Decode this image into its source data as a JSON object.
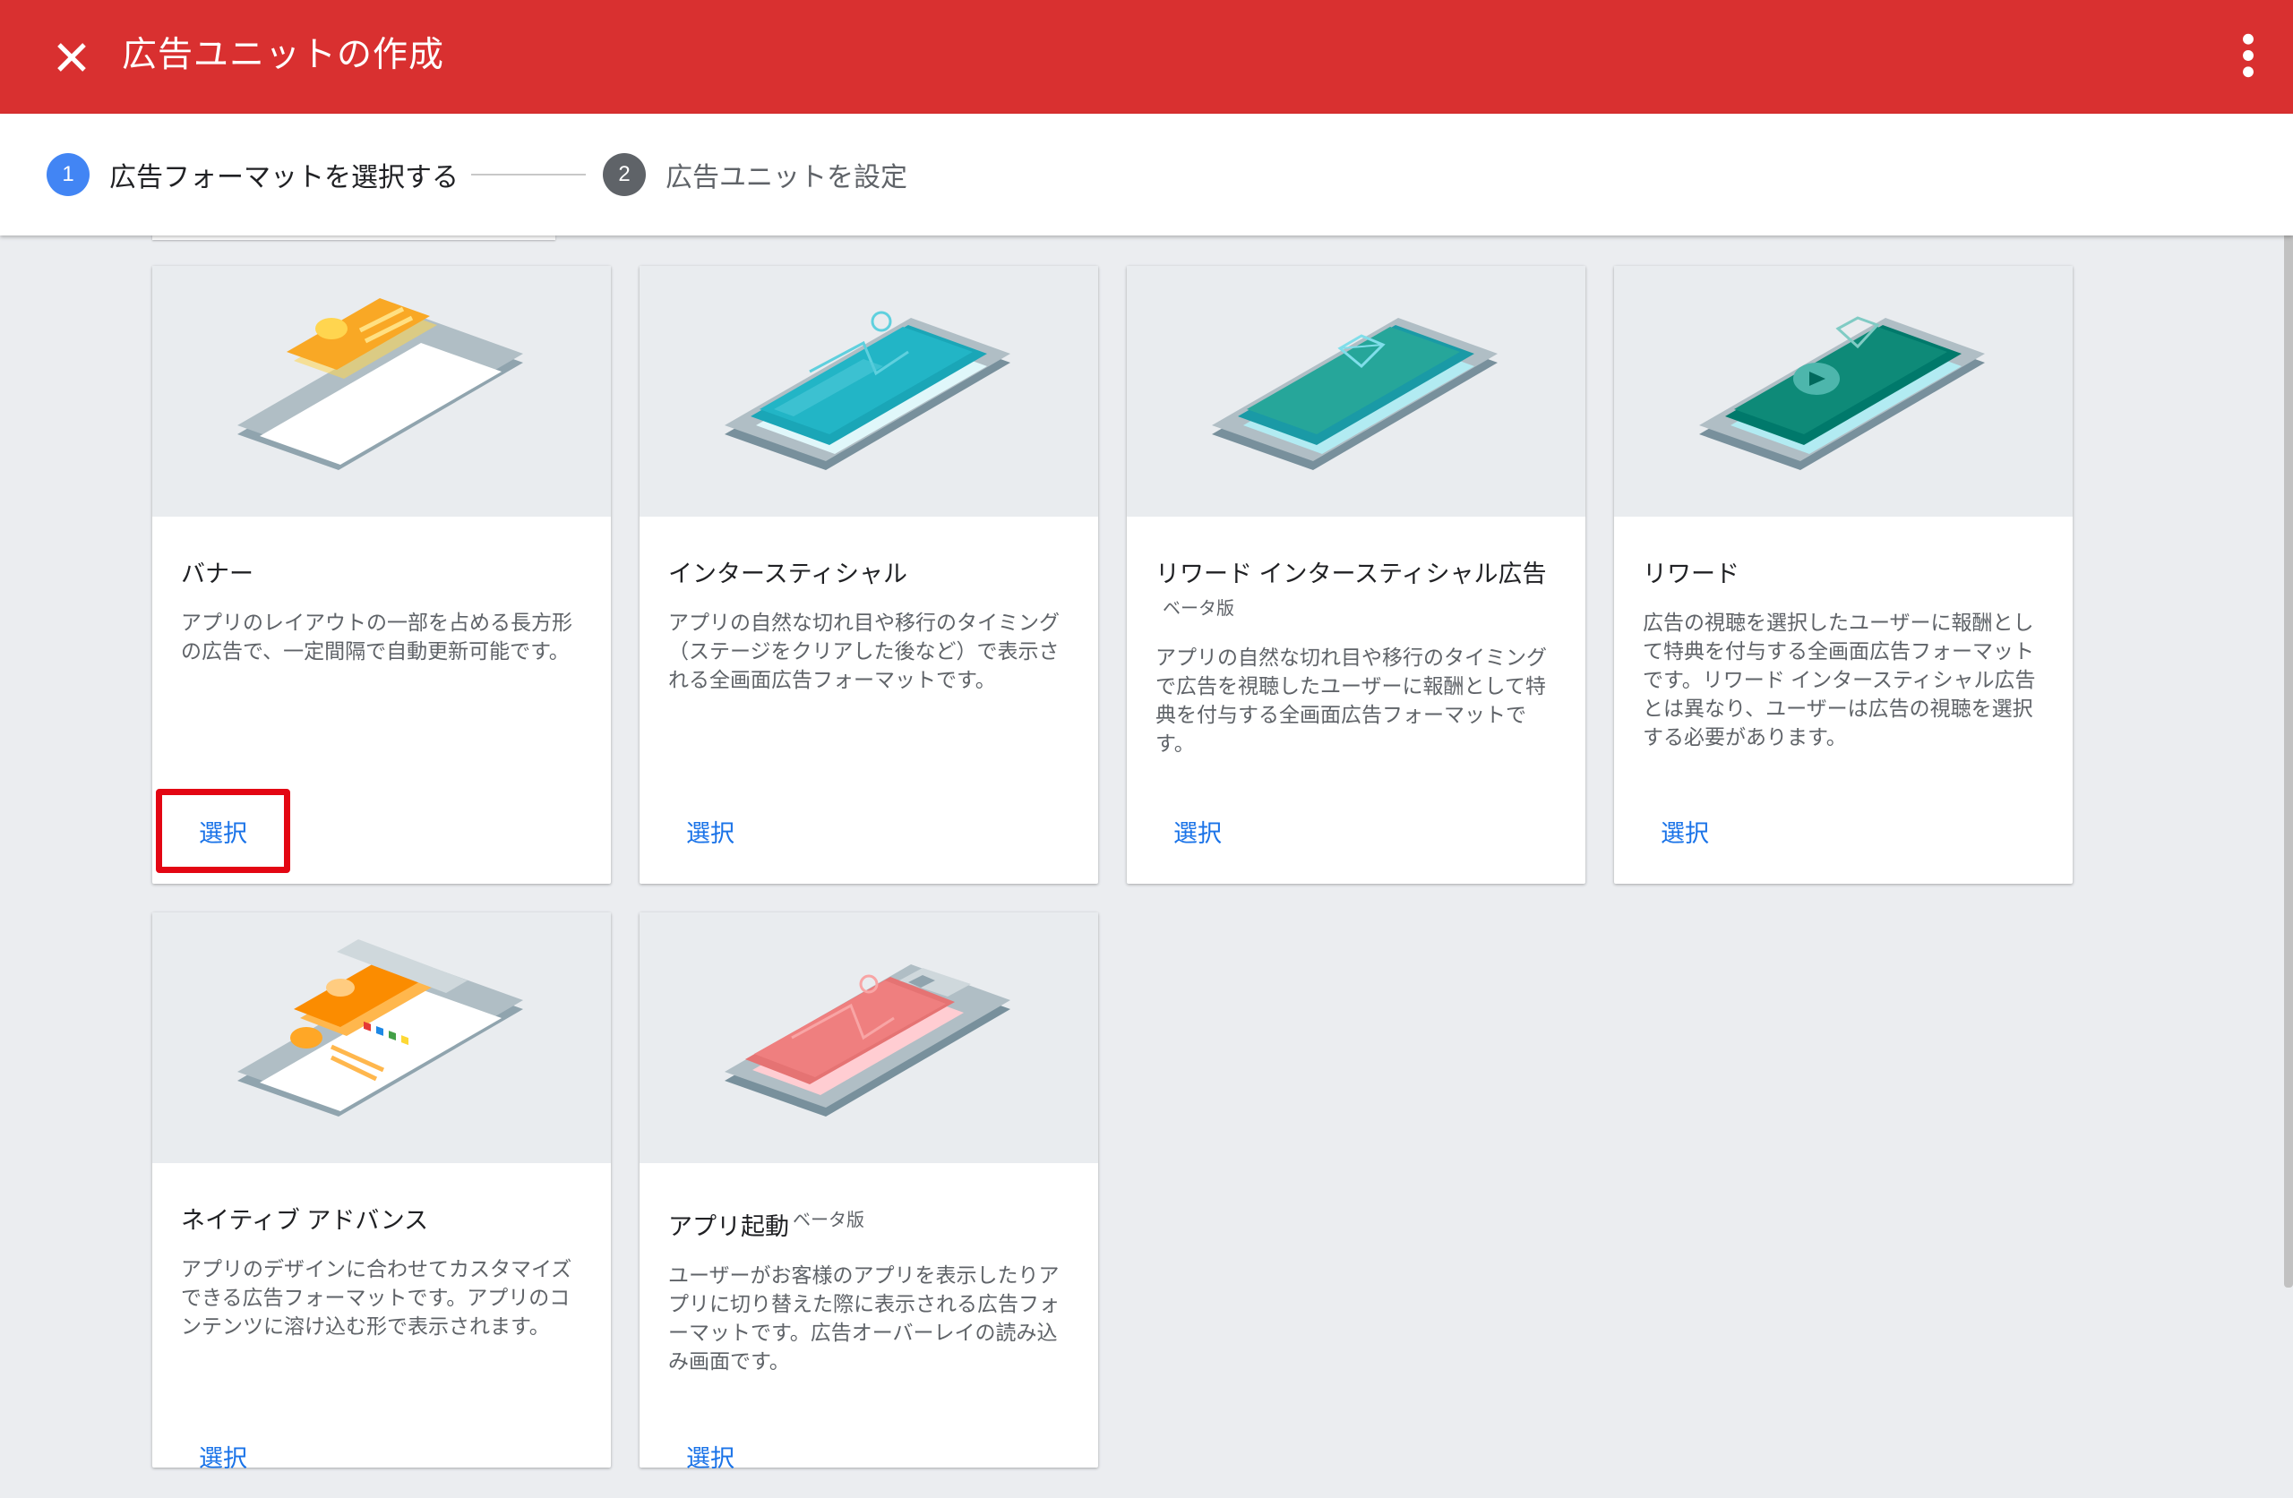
{
  "header": {
    "title": "広告ユニットの作成",
    "close_icon": "close-icon",
    "more_icon": "more-vert-icon",
    "color": "#d93030"
  },
  "stepper": {
    "steps": [
      {
        "number": "1",
        "label": "広告フォーマットを選択する",
        "state": "active"
      },
      {
        "number": "2",
        "label": "広告ユニットを設定",
        "state": "inactive"
      }
    ]
  },
  "cards": [
    {
      "title": "バナー",
      "description": "アプリのレイアウトの一部を占める長方形の広告で、一定間隔で自動更新可能です。",
      "select_label": "選択",
      "illustration": "banner-illustration",
      "highlighted": true
    },
    {
      "title": "インタースティシャル",
      "description": "アプリの自然な切れ目や移行のタイミング（ステージをクリアした後など）で表示される全画面広告フォーマットです。",
      "select_label": "選択",
      "illustration": "interstitial-illustration"
    },
    {
      "title": "リワード インタースティシャル広告",
      "beta": "ベータ版",
      "description": "アプリの自然な切れ目や移行のタイミングで広告を視聴したユーザーに報酬として特典を付与する全画面広告フォーマットです。",
      "select_label": "選択",
      "illustration": "rewarded-interstitial-illustration"
    },
    {
      "title": "リワード",
      "description": "広告の視聴を選択したユーザーに報酬として特典を付与する全画面広告フォーマットです。リワード インタースティシャル広告とは異なり、ユーザーは広告の視聴を選択する必要があります。",
      "select_label": "選択",
      "illustration": "rewarded-illustration"
    },
    {
      "title": "ネイティブ アドバンス",
      "description": "アプリのデザインに合わせてカスタマイズできる広告フォーマットです。アプリのコンテンツに溶け込む形で表示されます。",
      "select_label": "選択",
      "illustration": "native-advanced-illustration"
    },
    {
      "title": "アプリ起動",
      "beta": "ベータ版",
      "description": "ユーザーがお客様のアプリを表示したりアプリに切り替えた際に表示される広告フォーマットです。広告オーバーレイの読み込み画面です。",
      "select_label": "選択",
      "illustration": "app-open-illustration"
    }
  ],
  "colors": {
    "accent_blue": "#1a73e8",
    "step_active": "#4285f4",
    "highlight_red": "#e30613"
  }
}
